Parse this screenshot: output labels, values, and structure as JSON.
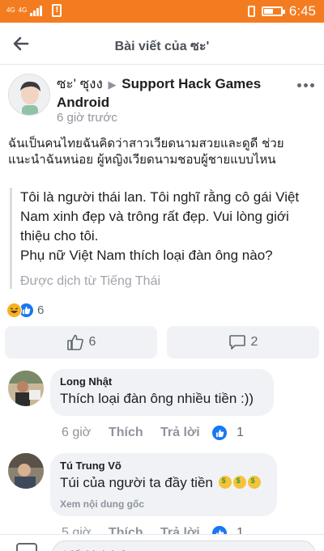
{
  "status_bar": {
    "network": "4G",
    "network2": "4G",
    "time": "6:45",
    "battery_level": 0.55
  },
  "header": {
    "title": "Bài viết của ซะ'"
  },
  "post": {
    "author": "ซะ' ซุงง",
    "group": "Support Hack Games Android",
    "time": "6 giờ trước",
    "original_text": "ฉันเป็นคนไทยฉันคิดว่าสาวเวียดนามสวยและดูดี ช่วยแนะนำฉันหน่อย ผู้หญิงเวียดนามชอบผู้ชายแบบไหน",
    "translation": [
      "Tôi là người thái lan. Tôi nghĩ rằng cô gái Việt Nam xinh đẹp và trông rất đẹp. Vui lòng giới thiệu cho tôi.",
      "Phụ nữ Việt Nam thích loại đàn ông nào?"
    ],
    "translated_from": "Được dịch từ Tiếng Thái",
    "reaction_count": "6",
    "like_count": "6",
    "comment_count": "2"
  },
  "comments": [
    {
      "name": "Long Nhật",
      "text": "Thích loại đàn ông nhiều tiền :))",
      "time": "6 giờ",
      "like_label": "Thích",
      "reply_label": "Trả lời",
      "likes": "1"
    },
    {
      "name": "Tú Trung Võ",
      "text": "Túi của người ta đầy tiền",
      "see_original": "Xem nội dung gốc",
      "time": "5 giờ",
      "like_label": "Thích",
      "reply_label": "Trả lời",
      "likes": "1"
    }
  ],
  "input": {
    "placeholder": "Viết bình luận..."
  },
  "colors": {
    "status_bar": "#f47c20",
    "facebook_blue": "#1877f2",
    "bubble": "#f0f2f5"
  }
}
